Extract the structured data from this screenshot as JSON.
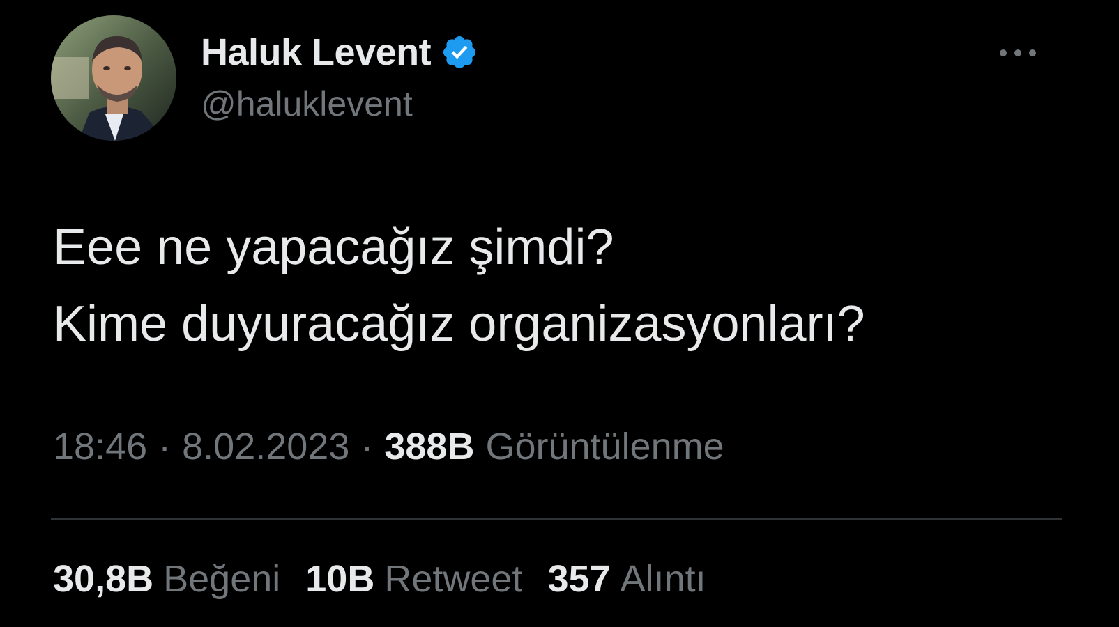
{
  "theme": {
    "background": "#000000",
    "text_primary": "#e7e9ea",
    "text_secondary": "#71767b",
    "accent_verified": "#1d9bf0",
    "divider": "#2f3336"
  },
  "author": {
    "display_name": "Haluk Levent",
    "handle": "@haluklevent",
    "verified": true,
    "avatar_icon": "profile-photo",
    "verified_icon": "verified-badge-icon"
  },
  "more_icon": "more-options-icon",
  "tweet": {
    "text": "Eee ne yapacağız şimdi?\nKime duyuracağız organizasyonları?",
    "time": "18:46",
    "separator": "·",
    "date": "8.02.2023",
    "views_count": "388B",
    "views_label": "Görüntülenme"
  },
  "stats": {
    "likes_count": "30,8B",
    "likes_label": "Beğeni",
    "retweets_count": "10B",
    "retweets_label": "Retweet",
    "quotes_count": "357",
    "quotes_label": "Alıntı"
  }
}
